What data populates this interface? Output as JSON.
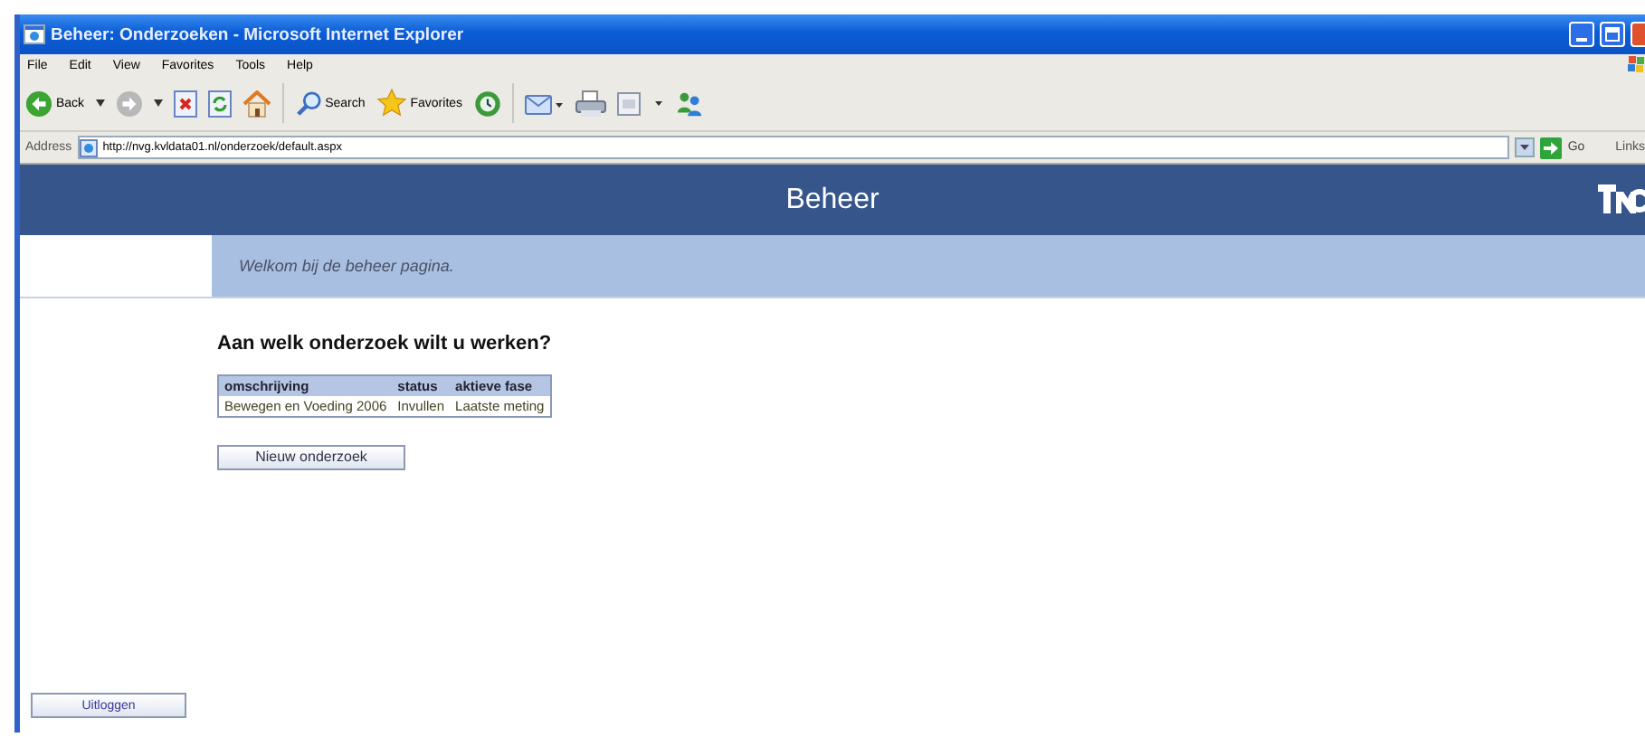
{
  "window": {
    "title": "Beheer: Onderzoeken - Microsoft Internet Explorer"
  },
  "menu": [
    "File",
    "Edit",
    "View",
    "Favorites",
    "Tools",
    "Help"
  ],
  "toolbar": [
    {
      "kind": "back",
      "label": "Back"
    },
    {
      "kind": "forward"
    },
    {
      "kind": "stop"
    },
    {
      "kind": "refresh"
    },
    {
      "kind": "home"
    },
    {
      "kind": "search",
      "label": "Search"
    },
    {
      "kind": "favorites",
      "label": "Favorites"
    },
    {
      "kind": "history"
    },
    {
      "kind": "mail"
    },
    {
      "kind": "print"
    },
    {
      "kind": "edit"
    },
    {
      "kind": "messenger"
    }
  ],
  "address": {
    "label": "Address",
    "url": "http://nvg.kvldata01.nl/onderzoek/default.aspx",
    "go": "Go",
    "links": "Links"
  },
  "header": {
    "title": "Beheer"
  },
  "welcome": "Welkom bij de beheer pagina.",
  "heading": "Aan welk onderzoek wilt u werken?",
  "table": {
    "columns": [
      "omschrijving",
      "status",
      "aktieve fase"
    ],
    "rows": [
      [
        "Bewegen en Voeding 2006",
        "Invullen",
        "Laatste meting"
      ]
    ]
  },
  "new_button": "Nieuw onderzoek",
  "logout_button": "Uitloggen"
}
